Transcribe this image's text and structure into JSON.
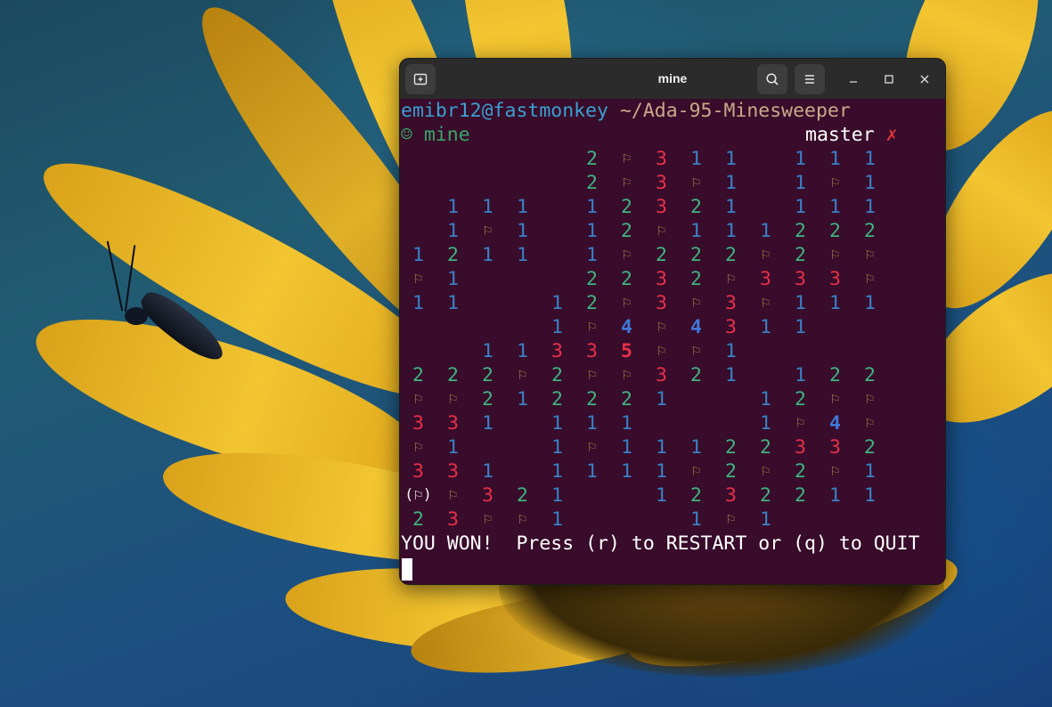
{
  "window": {
    "title": "mine"
  },
  "icons": {
    "new_tab": "new-tab-icon",
    "search": "search-icon",
    "menu": "hamburger-menu-icon",
    "minimize": "minimize-icon",
    "maximize": "maximize-icon",
    "close": "close-icon"
  },
  "terminal": {
    "user_host": "emibr12@fastmonkey",
    "path": "~/Ada-95-Minesweeper",
    "smiley": "☺",
    "dir_name": "mine",
    "branch": "master",
    "branch_status": "✗",
    "status_message": "YOU WON!  Press (r) to RESTART or (q) to QUIT"
  },
  "colors": {
    "terminal_bg": "#380c2a",
    "one": "#3a80c4",
    "two": "#3fb380",
    "three": "#e8304a",
    "four": "#3f78d8",
    "five": "#e8304a",
    "flag": "#a67a4a"
  },
  "board": {
    "rows": [
      [
        " ",
        " ",
        " ",
        " ",
        " ",
        "2",
        "F",
        "3",
        "1",
        "1",
        " ",
        "1",
        "1",
        "1"
      ],
      [
        " ",
        " ",
        " ",
        " ",
        " ",
        "2",
        "F",
        "3",
        "F",
        "1",
        " ",
        "1",
        "F",
        "1"
      ],
      [
        " ",
        "1",
        "1",
        "1",
        " ",
        "1",
        "2",
        "3",
        "2",
        "1",
        " ",
        "1",
        "1",
        "1"
      ],
      [
        " ",
        "1",
        "F",
        "1",
        " ",
        "1",
        "2",
        "F",
        "1",
        "1",
        "1",
        "2",
        "2",
        "2"
      ],
      [
        "1",
        "2",
        "1",
        "1",
        " ",
        "1",
        "F",
        "2",
        "2",
        "2",
        "F",
        "2",
        "F",
        "F"
      ],
      [
        "F",
        "1",
        " ",
        " ",
        " ",
        "2",
        "2",
        "3",
        "2",
        "F",
        "3",
        "3",
        "3",
        "F"
      ],
      [
        "1",
        "1",
        " ",
        " ",
        "1",
        "2",
        "F",
        "3",
        "F",
        "3",
        "F",
        "1",
        "1",
        "1"
      ],
      [
        " ",
        " ",
        " ",
        " ",
        "1",
        "F",
        "4",
        "F",
        "4",
        "3",
        "1",
        "1",
        " ",
        " "
      ],
      [
        " ",
        " ",
        "1",
        "1",
        "3",
        "3",
        "5",
        "F",
        "F",
        "1",
        " ",
        " ",
        " ",
        " "
      ],
      [
        "2",
        "2",
        "2",
        "F",
        "2",
        "F",
        "F",
        "3",
        "2",
        "1",
        " ",
        "1",
        "2",
        "2"
      ],
      [
        "F",
        "F",
        "2",
        "1",
        "2",
        "2",
        "2",
        "1",
        " ",
        " ",
        "1",
        "2",
        "F",
        "F"
      ],
      [
        "3",
        "3",
        "1",
        " ",
        "1",
        "1",
        "1",
        " ",
        " ",
        " ",
        "1",
        "F",
        "4",
        "F"
      ],
      [
        "F",
        "1",
        " ",
        " ",
        "1",
        "F",
        "1",
        "1",
        "1",
        "2",
        "2",
        "3",
        "3",
        "2"
      ],
      [
        "3",
        "3",
        "1",
        " ",
        "1",
        "1",
        "1",
        "1",
        "F",
        "2",
        "F",
        "2",
        "F",
        "1"
      ],
      [
        "F",
        "F",
        "3",
        "2",
        "1",
        " ",
        " ",
        "1",
        "2",
        "3",
        "2",
        "2",
        "1",
        "1"
      ],
      [
        "2",
        "3",
        "F",
        "F",
        "1",
        " ",
        " ",
        " ",
        "1",
        "F",
        "1",
        " ",
        " ",
        " "
      ]
    ],
    "cursor": {
      "row": 14,
      "col": 0
    }
  }
}
